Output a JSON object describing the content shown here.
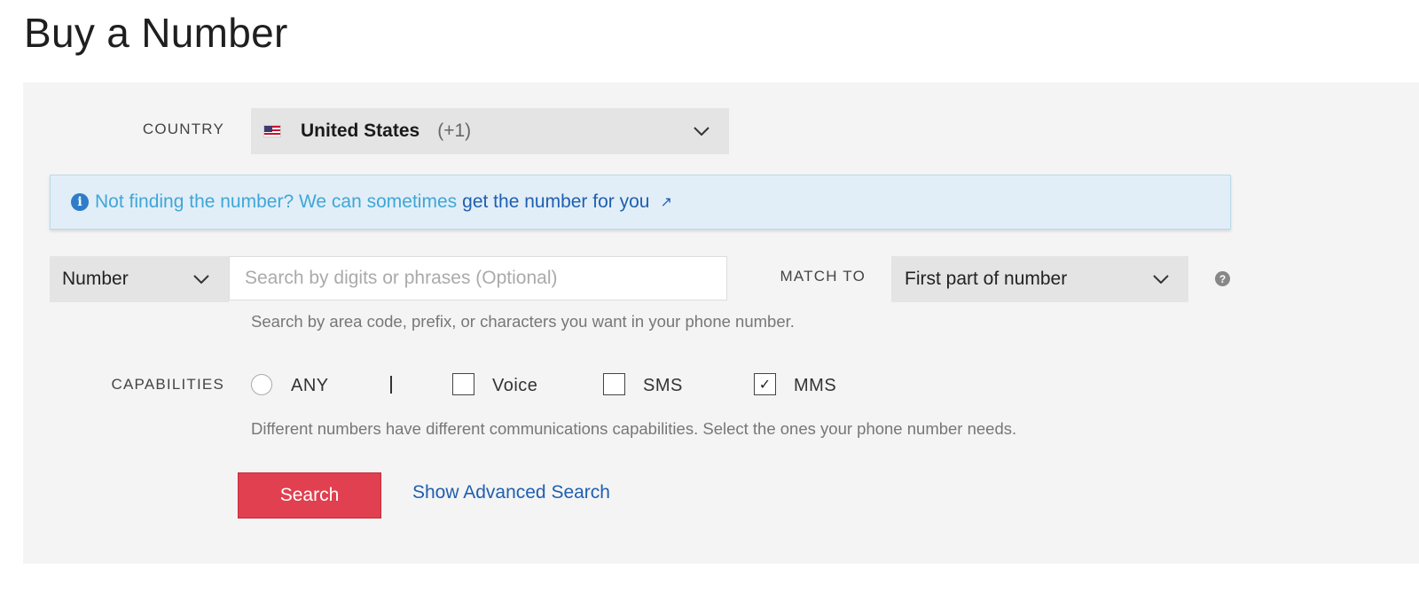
{
  "page": {
    "title": "Buy a Number"
  },
  "country": {
    "label": "COUNTRY",
    "selected_name": "United States",
    "selected_code": "(+1)",
    "flag_icon": "us-flag-icon"
  },
  "notice": {
    "text": "Not finding the number? We can sometimes",
    "link": "get the number for you",
    "icon": "info-icon",
    "link_icon": "external-link-icon"
  },
  "search": {
    "type_selected": "Number",
    "placeholder": "Search by digits or phrases (Optional)",
    "value": "",
    "match_label": "MATCH TO",
    "match_selected": "First part of number",
    "help_icon": "help-icon",
    "hint": "Search by area code, prefix, or characters you want in your phone number."
  },
  "capabilities": {
    "label": "CAPABILITIES",
    "any_label": "ANY",
    "options": [
      {
        "label": "Voice",
        "checked": false
      },
      {
        "label": "SMS",
        "checked": false
      },
      {
        "label": "MMS",
        "checked": true
      }
    ],
    "hint": "Different numbers have different communications capabilities. Select the ones your phone number needs."
  },
  "actions": {
    "search_label": "Search",
    "advanced_label": "Show Advanced Search"
  },
  "colors": {
    "primary_button": "#e0404f",
    "link": "#1f5fb0",
    "notice_bg": "#e1eef8",
    "notice_text": "#3fa6d6",
    "panel_bg": "#f4f4f4"
  }
}
